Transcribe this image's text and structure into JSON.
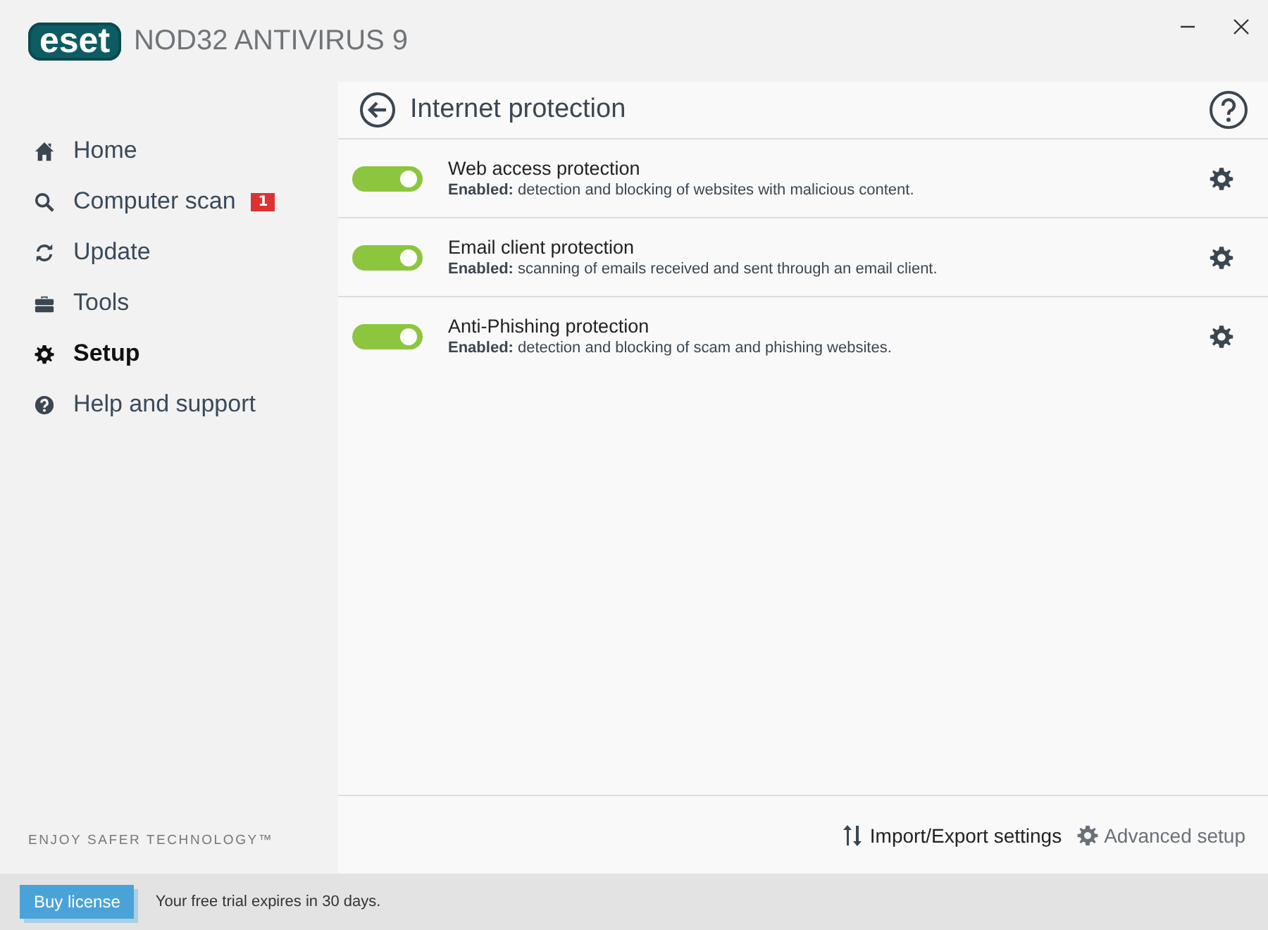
{
  "window": {
    "logo": "eset",
    "title": "NOD32 ANTIVIRUS 9"
  },
  "sidebar": {
    "items": [
      {
        "label": "Home",
        "selected": false
      },
      {
        "label": "Computer scan",
        "selected": false,
        "badge": "1"
      },
      {
        "label": "Update",
        "selected": false
      },
      {
        "label": "Tools",
        "selected": false
      },
      {
        "label": "Setup",
        "selected": true
      },
      {
        "label": "Help and support",
        "selected": false
      }
    ],
    "tagline": "ENJOY SAFER TECHNOLOGY™"
  },
  "page": {
    "title": "Internet protection",
    "modules": [
      {
        "name": "Web access protection",
        "status": "Enabled:",
        "description": "detection and blocking of websites with malicious content.",
        "on": true
      },
      {
        "name": "Email client protection",
        "status": "Enabled:",
        "description": "scanning of emails received and sent through an email client.",
        "on": true
      },
      {
        "name": "Anti-Phishing protection",
        "status": "Enabled:",
        "description": "detection and blocking of scam and phishing websites.",
        "on": true
      }
    ],
    "links": [
      {
        "label": "Import/Export settings"
      },
      {
        "label": "Advanced setup"
      }
    ]
  },
  "status_bar": {
    "button": "Buy license",
    "message": "Your free trial expires in 30 days."
  }
}
